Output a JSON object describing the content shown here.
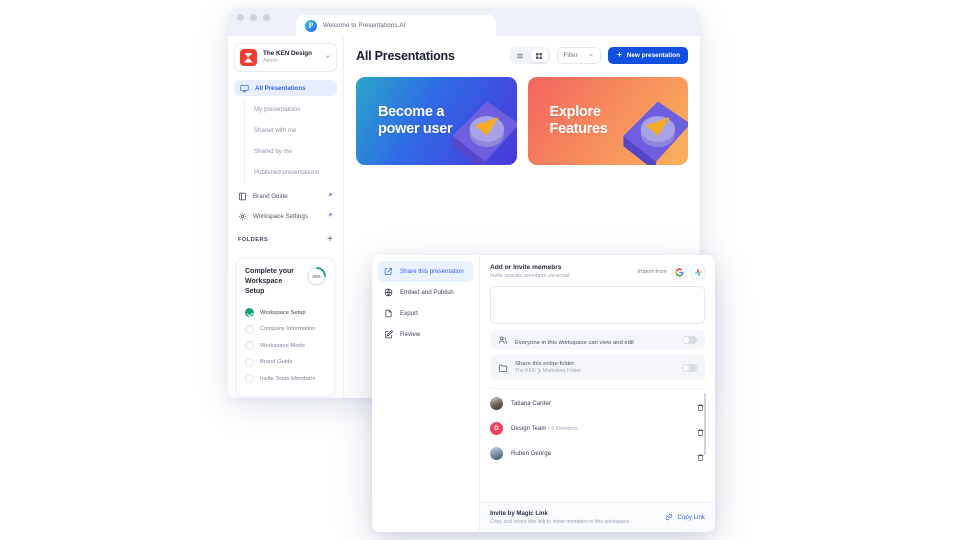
{
  "browser": {
    "tab": {
      "title": "Welcome to Presentations.AI",
      "favicon": "presentations-ai-logo"
    },
    "window_controls": [
      "close",
      "minimize",
      "maximize"
    ]
  },
  "sidebar": {
    "org": {
      "name": "The KEN Design",
      "role": "Admin",
      "chevron": "chevron-down-icon"
    },
    "nav": [
      {
        "label": "All Presentations",
        "icon": "presentation-icon",
        "active": true
      }
    ],
    "subnav": [
      {
        "label": "My presentations"
      },
      {
        "label": "Shared with me"
      },
      {
        "label": "Shared by me"
      },
      {
        "label": "Published presentations"
      }
    ],
    "extras": [
      {
        "label": "Brand Guide",
        "icon": "brand-guide-icon",
        "badge": "external-link-icon"
      },
      {
        "label": "Workspace Settings",
        "icon": "gear-icon",
        "badge": "external-link-icon"
      }
    ],
    "folders": {
      "label": "FOLDERS",
      "add": "+"
    },
    "setup": {
      "title": "Complete your Workspace Setup",
      "progress": "25%",
      "progress_value": 25,
      "items": [
        {
          "label": "Workspace Setup",
          "done": true
        },
        {
          "label": "Company Information",
          "done": false
        },
        {
          "label": "Workspace Mode",
          "done": false
        },
        {
          "label": "Brand Guide",
          "done": false
        },
        {
          "label": "Invite Team Members",
          "done": false
        }
      ]
    }
  },
  "main": {
    "title": "All Presentations",
    "view_toggle": [
      {
        "name": "list-view",
        "active": false
      },
      {
        "name": "grid-view",
        "active": true
      }
    ],
    "filter": {
      "label": "Filter",
      "chevron": "chevron-down-icon"
    },
    "new_button": {
      "label": "New presentation",
      "icon": "plus-icon"
    },
    "banners": [
      {
        "line1": "Become a",
        "line2": "power user",
        "theme": "blue"
      },
      {
        "line1": "Explore",
        "line2": "Features",
        "theme": "orange"
      }
    ]
  },
  "modal": {
    "menu": [
      {
        "label": "Share this presentation",
        "icon": "share-icon",
        "active": true
      },
      {
        "label": "Embed and Publish",
        "icon": "globe-icon",
        "active": false
      },
      {
        "label": "Export",
        "icon": "file-icon",
        "active": false
      },
      {
        "label": "Review",
        "icon": "review-pen-icon",
        "active": false
      }
    ],
    "invite": {
      "title": "Add or Invite memebrs",
      "subtitle": "Invite specific members via email",
      "import_label": "Import from",
      "import_sources": [
        "google-icon",
        "slack-icon"
      ],
      "email_placeholder": ""
    },
    "options": [
      {
        "title": "Everyone in this workspace can view and edit",
        "subtitle": "",
        "icon": "people-icon",
        "enabled": false
      },
      {
        "title": "Share this entire folder",
        "subtitle": "The KEN  ❯  Marketing Folder",
        "icon": "folder-icon",
        "enabled": false
      }
    ],
    "people": [
      {
        "name": "Tatiana Carder",
        "meta": "",
        "avatar": "photo",
        "action": "delete-icon"
      },
      {
        "name": "Design Team",
        "meta": " • 8 Members",
        "avatar": "D",
        "action": "delete-icon"
      },
      {
        "name": "Ruben George",
        "meta": "",
        "avatar": "photo",
        "action": "delete-icon"
      }
    ],
    "footer": {
      "title": "Invite by Magic Link",
      "subtitle": "Copy and share this link to invite members to this workspace",
      "copy_label": "Copy Link",
      "copy_icon": "link-icon"
    }
  },
  "colors": {
    "accent_blue": "#1450e0",
    "nav_active_bg": "#e7efff",
    "green": "#16a36a",
    "team_red": "#f2415c",
    "logo_red": "#f43d2e"
  }
}
